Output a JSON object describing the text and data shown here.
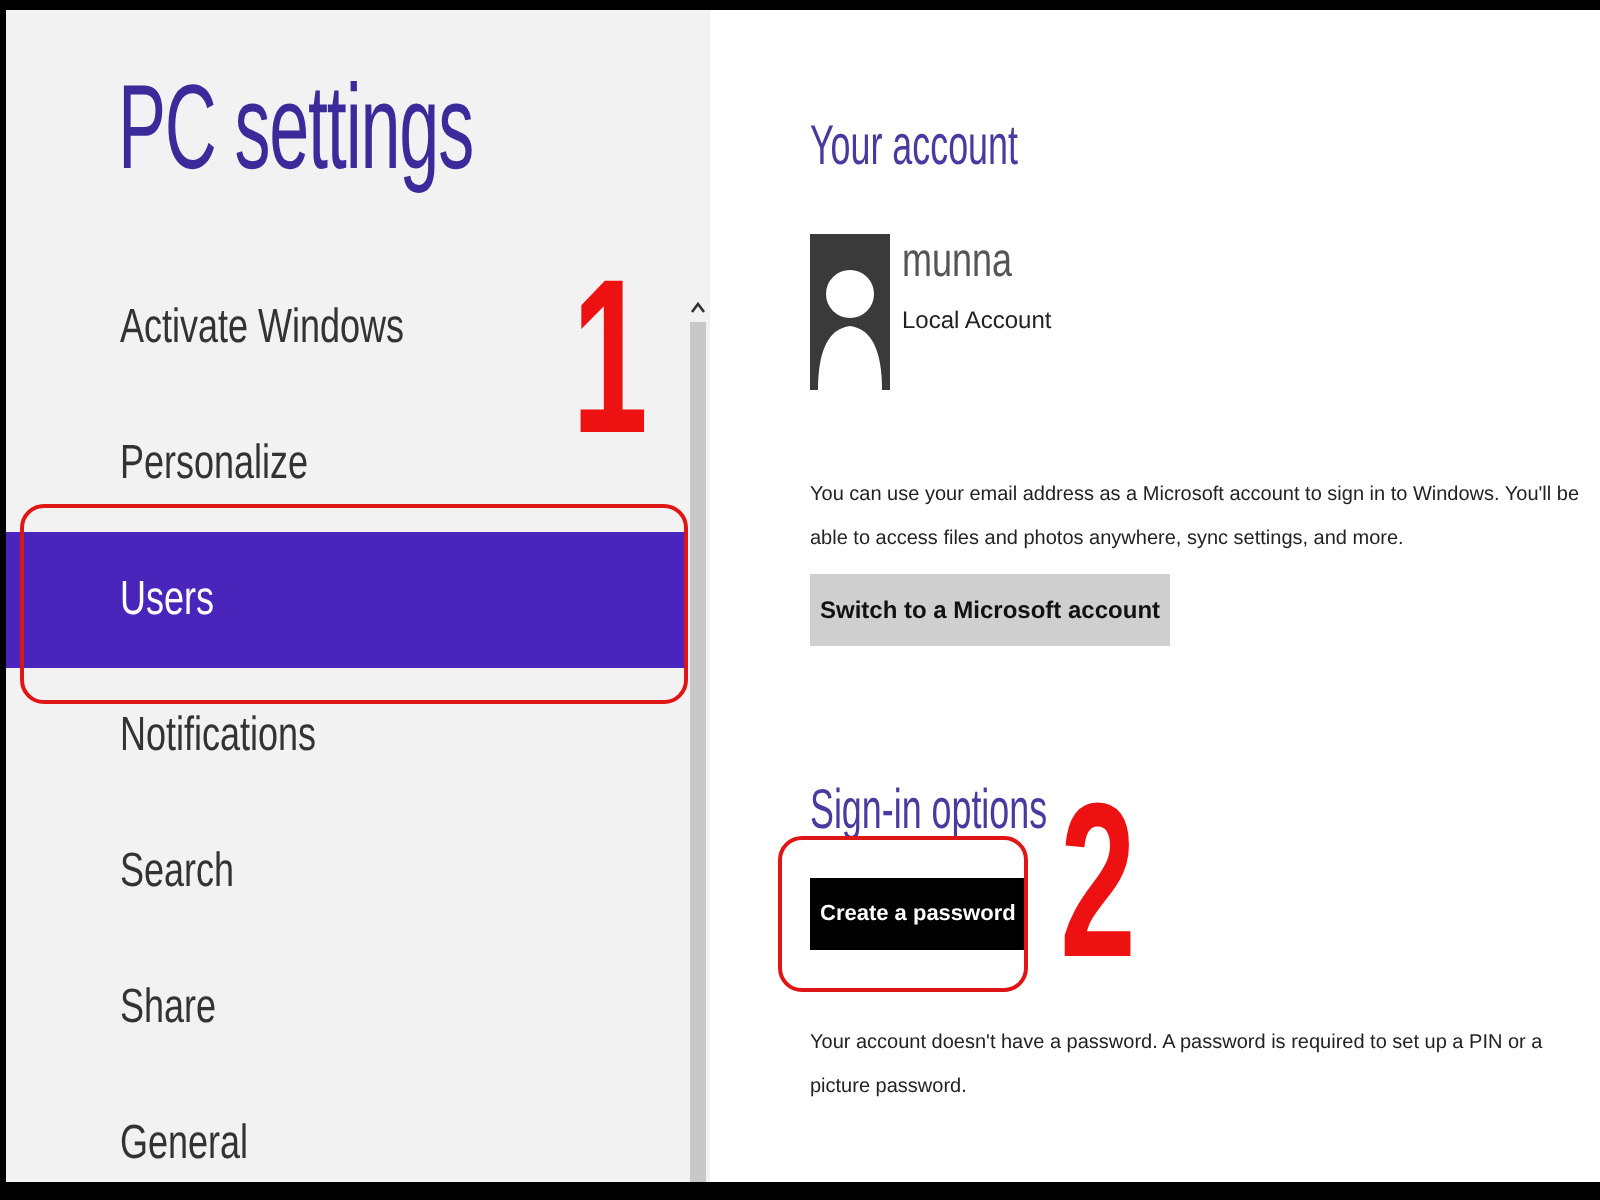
{
  "title": "PC settings",
  "sidebar": {
    "items": [
      {
        "label": "Activate Windows",
        "selected": false
      },
      {
        "label": "Personalize",
        "selected": false
      },
      {
        "label": "Users",
        "selected": true
      },
      {
        "label": "Notifications",
        "selected": false
      },
      {
        "label": "Search",
        "selected": false
      },
      {
        "label": "Share",
        "selected": false
      },
      {
        "label": "General",
        "selected": false
      }
    ]
  },
  "account": {
    "heading": "Your account",
    "user_name": "munna",
    "account_type": "Local Account",
    "description": "You can use your email address as a Microsoft account to sign in to Windows. You'll be able to access files and photos anywhere, sync settings, and more.",
    "button": "Switch to a Microsoft account"
  },
  "sign_in": {
    "heading": "Sign-in options",
    "button": "Create a password",
    "description": "Your account doesn't have a password. A password is required to set up a PIN or a picture password."
  },
  "annotations": [
    {
      "label": "1"
    },
    {
      "label": "2"
    }
  ]
}
